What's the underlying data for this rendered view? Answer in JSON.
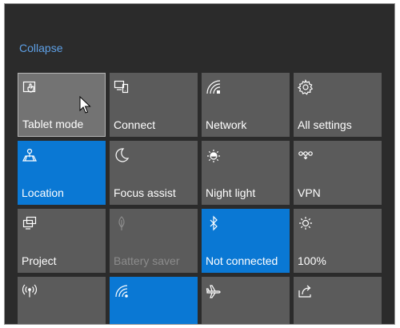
{
  "panel": {
    "collapse_label": "Collapse"
  },
  "tiles": [
    {
      "label": "Tablet mode",
      "icon": "tablet-mode-icon",
      "state": "hover"
    },
    {
      "label": "Connect",
      "icon": "connect-icon",
      "state": "off"
    },
    {
      "label": "Network",
      "icon": "network-icon",
      "state": "off"
    },
    {
      "label": "All settings",
      "icon": "gear-icon",
      "state": "off"
    },
    {
      "label": "Location",
      "icon": "location-icon",
      "state": "on"
    },
    {
      "label": "Focus assist",
      "icon": "moon-icon",
      "state": "off"
    },
    {
      "label": "Night light",
      "icon": "brightness-icon",
      "state": "off"
    },
    {
      "label": "VPN",
      "icon": "vpn-icon",
      "state": "off"
    },
    {
      "label": "Project",
      "icon": "project-icon",
      "state": "off"
    },
    {
      "label": "Battery saver",
      "icon": "battery-saver-icon",
      "state": "disabled"
    },
    {
      "label": "Not connected",
      "icon": "bluetooth-icon",
      "state": "on"
    },
    {
      "label": "100%",
      "icon": "brightness-icon",
      "state": "off"
    },
    {
      "label": "",
      "icon": "mobile-hotspot-icon",
      "state": "off"
    },
    {
      "label": "",
      "icon": "wifi-icon",
      "state": "on"
    },
    {
      "label": "",
      "icon": "airplane-icon",
      "state": "off"
    },
    {
      "label": "",
      "icon": "share-icon",
      "state": "off"
    }
  ],
  "colors": {
    "background": "#2b2b2b",
    "tile": "#5b5b5b",
    "tile_active": "#0a78d4",
    "link": "#5ea0e6"
  }
}
